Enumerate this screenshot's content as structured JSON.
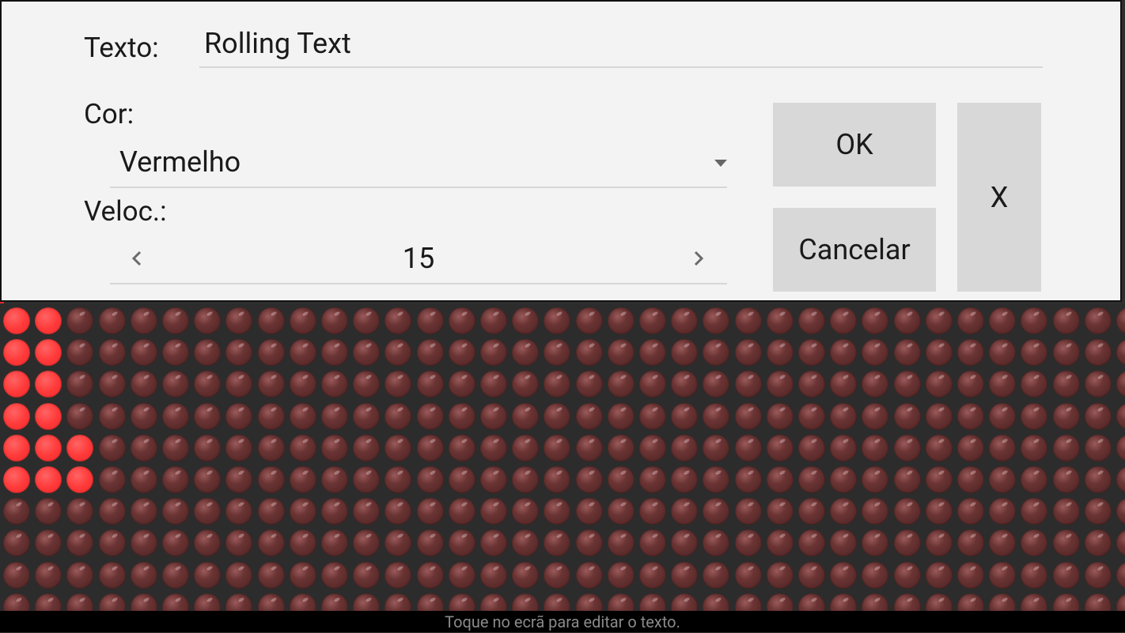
{
  "dialog": {
    "text_label": "Texto:",
    "text_value": "Rolling Text",
    "color_label": "Cor:",
    "color_value": "Vermelho",
    "speed_label": "Veloc.:",
    "speed_value": "15",
    "ok_label": "OK",
    "cancel_label": "Cancelar",
    "close_label": "X"
  },
  "status_bar": {
    "hint": "Toque no ecrã para editar o texto."
  },
  "led_display": {
    "color_on": "#ff3a3a",
    "color_off": "#5a2a2a",
    "lit_pixels": [
      [
        0,
        0
      ],
      [
        0,
        1
      ],
      [
        0,
        2
      ],
      [
        0,
        3
      ],
      [
        0,
        4
      ],
      [
        0,
        5
      ],
      [
        1,
        0
      ],
      [
        1,
        1
      ],
      [
        1,
        2
      ],
      [
        1,
        3
      ],
      [
        1,
        4
      ],
      [
        1,
        5
      ],
      [
        2,
        4
      ],
      [
        2,
        5
      ]
    ]
  },
  "icons": {
    "decrease": "chevron-left-icon",
    "increase": "chevron-right-icon",
    "dropdown": "caret-down-icon"
  }
}
